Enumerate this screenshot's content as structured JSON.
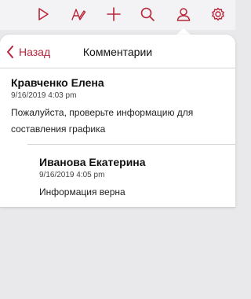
{
  "toolbar": {
    "icons": [
      "play-icon",
      "edit-text-icon",
      "plus-icon",
      "search-icon",
      "person-icon",
      "gear-icon"
    ],
    "accent": "#b8263a"
  },
  "popover": {
    "back_label": "Назад",
    "title": "Комментарии"
  },
  "comments": [
    {
      "author": "Кравченко Елена",
      "date": "9/16/2019 4:03 pm",
      "text": "Пожалуйста, проверьте информацию для составления графика"
    },
    {
      "author": "Иванова Екатерина",
      "date": "9/16/2019 4:05 pm",
      "text": "Информация верна"
    }
  ]
}
